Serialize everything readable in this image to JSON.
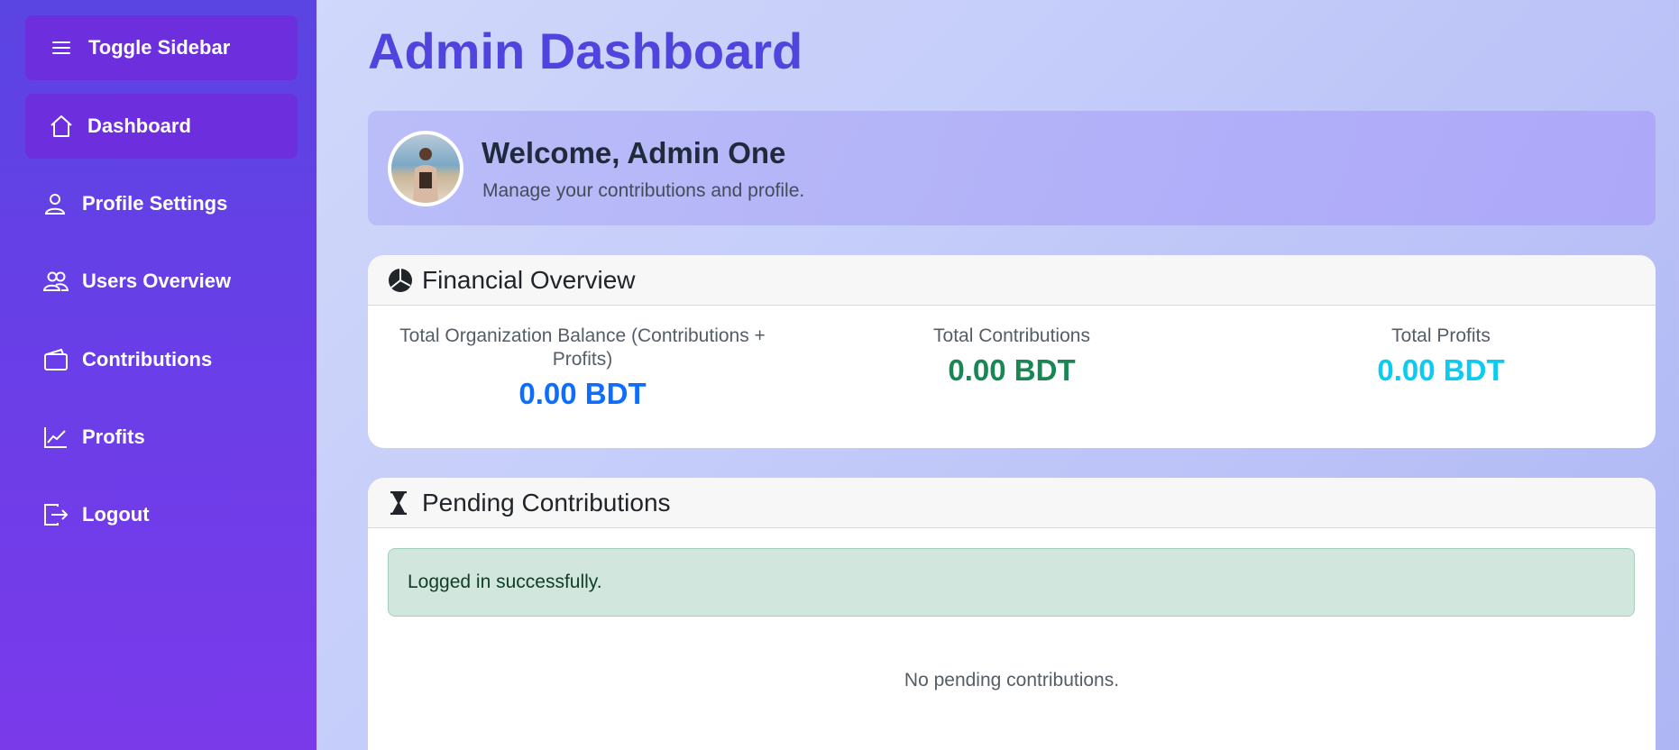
{
  "sidebar": {
    "toggle_label": "Toggle Sidebar",
    "items": [
      {
        "label": "Dashboard",
        "icon": "home-icon",
        "active": true
      },
      {
        "label": "Profile Settings",
        "icon": "user-icon"
      },
      {
        "label": "Users Overview",
        "icon": "users-icon"
      },
      {
        "label": "Contributions",
        "icon": "wallet-icon"
      },
      {
        "label": "Profits",
        "icon": "chart-line-icon"
      },
      {
        "label": "Logout",
        "icon": "logout-icon"
      }
    ]
  },
  "page": {
    "title": "Admin Dashboard"
  },
  "welcome": {
    "title": "Welcome, Admin One",
    "subtitle": "Manage your contributions and profile."
  },
  "financial": {
    "header": "Financial Overview",
    "stats": [
      {
        "label": "Total Organization Balance (Contributions + Profits)",
        "value": "0.00 BDT",
        "color": "#0d6efd"
      },
      {
        "label": "Total Contributions",
        "value": "0.00 BDT",
        "color": "#198754"
      },
      {
        "label": "Total Profits",
        "value": "0.00 BDT",
        "color": "#0dcaf0"
      }
    ]
  },
  "pending": {
    "header": "Pending Contributions",
    "alert": "Logged in successfully.",
    "empty": "No pending contributions."
  },
  "colors": {
    "accent": "#5043de",
    "sidebar_active": "#6d2ede"
  }
}
